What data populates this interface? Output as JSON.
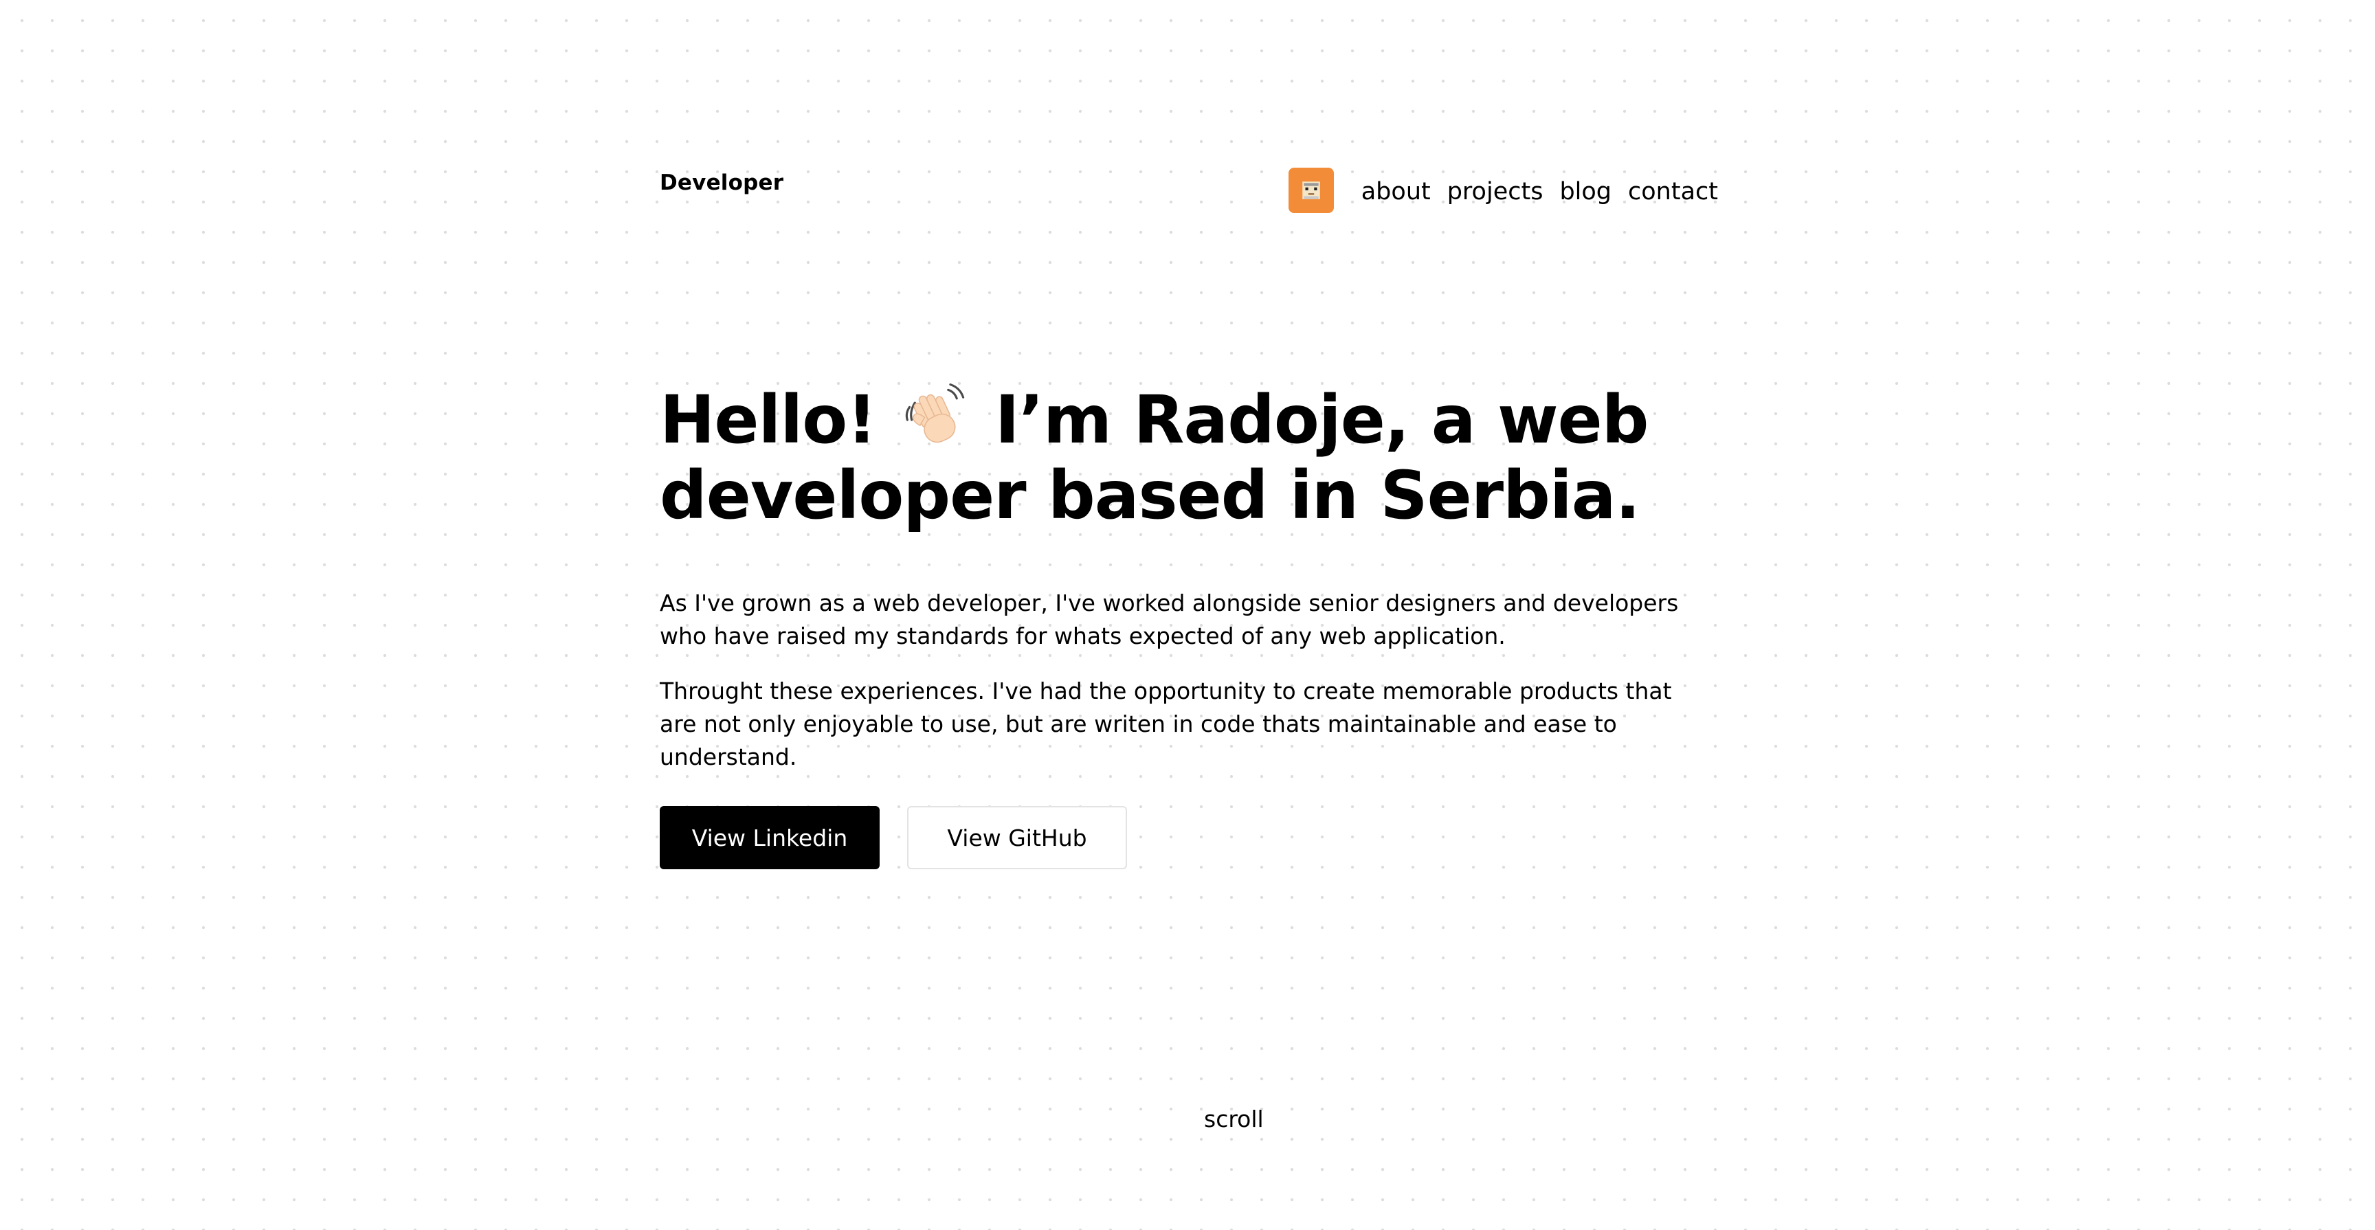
{
  "header": {
    "brand": "Developer",
    "nav": {
      "avatar_icon": "pixel-avatar-icon",
      "avatar_color": "#f28c38",
      "links": [
        {
          "label": "about"
        },
        {
          "label": "projects"
        },
        {
          "label": "blog"
        },
        {
          "label": "contact"
        }
      ]
    }
  },
  "hero": {
    "headline_part1": "Hello!",
    "wave_icon": "waving-hand-icon",
    "headline_part2": "I’m Radoje, a web",
    "headline_line2": "developer based in Serbia.",
    "paragraphs": [
      "As I've grown as a web developer, I've worked alongside senior designers and developers who have raised my standards for whats expected of any web application.",
      "Throught these experiences. I've had the opportunity to create memorable products that are not only enjoyable to use, but are writen in code thats maintainable and ease to understand."
    ],
    "buttons": {
      "primary_label": "View Linkedin",
      "secondary_label": "View GitHub"
    }
  },
  "footer": {
    "scroll_label": "scroll"
  },
  "colors": {
    "background": "#ffffff",
    "text": "#000000",
    "accent": "#f28c38",
    "dot_grid": "#dcdcdc"
  }
}
